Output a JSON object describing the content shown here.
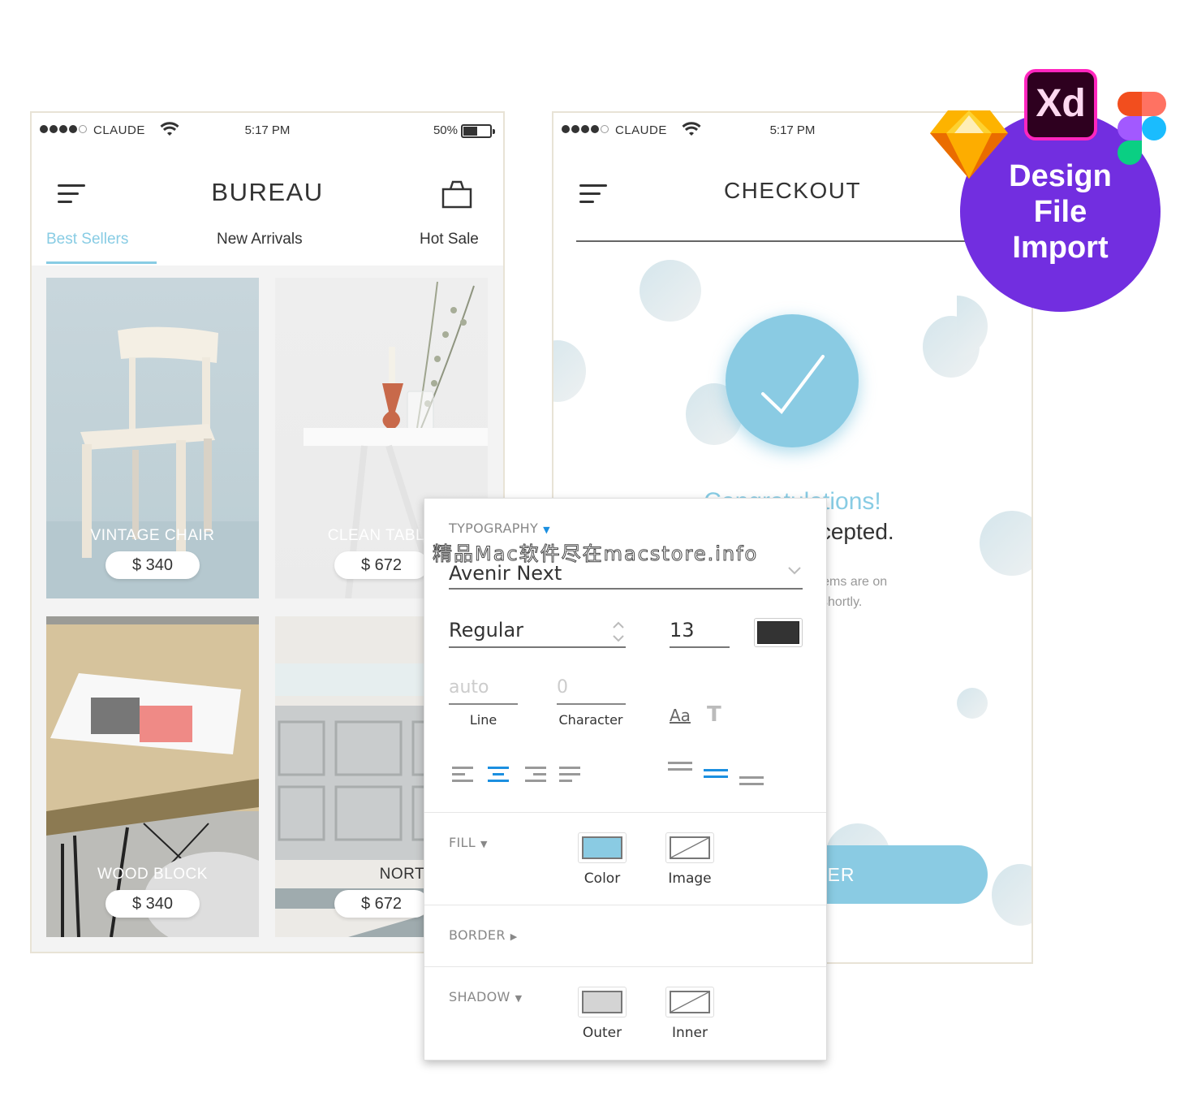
{
  "colors": {
    "accent": "#88cce4",
    "badge": "#722ee0",
    "panel_blue": "#1b8fe0",
    "text_dark": "#333333"
  },
  "bureau": {
    "status": {
      "signal_bars": 4,
      "carrier": "CLAUDE",
      "wifi_icon": "wifi-icon",
      "time": "5:17 PM",
      "battery_pct": "50%",
      "battery_level": 0.5
    },
    "title": "BUREAU",
    "menu_icon": "hamburger-menu-icon",
    "cart_icon": "shopping-bag-icon",
    "tabs": [
      {
        "label": "Best Sellers",
        "active": true
      },
      {
        "label": "New Arrivals",
        "active": false
      },
      {
        "label": "Hot Sale",
        "active": false
      }
    ],
    "products": [
      {
        "name": "VINTAGE CHAIR",
        "price": "$ 340"
      },
      {
        "name": "CLEAN TABLE",
        "price": "$ 672"
      },
      {
        "name": "WOOD BLOCK",
        "price": "$ 340"
      },
      {
        "name": "NORT SHELF",
        "price": "$ 672"
      }
    ]
  },
  "checkout": {
    "status": {
      "signal_bars": 4,
      "carrier": "CLAUDE",
      "time": "5:17 PM"
    },
    "title": "CHECKOUT",
    "success_icon": "checkmark-icon",
    "congrats": "Congratulations!",
    "accepted": "en accepted.",
    "message_line1": "! Your items are on",
    "message_line2": "ve shortly.",
    "order_button": "ORDER"
  },
  "badge": {
    "lines": [
      "Design",
      "File",
      "Import"
    ],
    "xd_label": "Xd",
    "logos": [
      "sketch-logo",
      "adobe-xd-logo",
      "figma-logo"
    ]
  },
  "panel": {
    "watermark": "精品Mac软件尽在macstore.info",
    "typography": {
      "label": "TYPOGRAPHY",
      "expanded": true,
      "font_family": "Avenir Next",
      "font_weight": "Regular",
      "font_size": "13",
      "color_swatch": "#333333",
      "line_placeholder": "auto",
      "line_label": "Line",
      "char_placeholder": "0",
      "char_label": "Character",
      "text_case_icon": "Aa",
      "text_style_icon": "T",
      "align_selected": "center",
      "valign_selected": "middle"
    },
    "fill": {
      "label": "FILL",
      "expanded": true,
      "options": [
        {
          "label": "Color",
          "swatch": "#8acbe3"
        },
        {
          "label": "Image"
        }
      ]
    },
    "border": {
      "label": "BORDER",
      "expanded": false
    },
    "shadow": {
      "label": "SHADOW",
      "expanded": true,
      "options": [
        {
          "label": "Outer",
          "swatch": "#d4d4d4"
        },
        {
          "label": "Inner"
        }
      ]
    }
  }
}
